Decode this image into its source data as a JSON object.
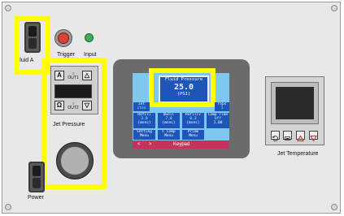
{
  "labels": {
    "fluid": "Fluid A",
    "trigger": "Trigger",
    "input": "Input",
    "jet_pressure": "Jet Pressure",
    "power": "Power",
    "jet_temperature": "Jet Temperature"
  },
  "pressure_controller": {
    "btn_a": "A",
    "btn_up": "△",
    "btn_omega": "Ω",
    "btn_down": "▽",
    "out1": "OUT1",
    "out2": "OUT2"
  },
  "touchscreen": {
    "popup": {
      "title": "Fluid Pressure",
      "value": "25.0",
      "unit": "(PSI)"
    },
    "row1": [
      {
        "label": "Jet",
        "value": "clos"
      },
      {
        "label": "rops",
        "value": "1"
      }
    ],
    "row2": [
      {
        "label": "Refill",
        "value": "3.0",
        "unit": "(msec)"
      },
      {
        "label": "Dwell",
        "value": "7.0",
        "unit": "(msec)"
      },
      {
        "label": "Refill+",
        "value": "0.3",
        "unit": "(msec)"
      },
      {
        "label": "Comp Time",
        "value": "Off",
        "unit": "1.00"
      }
    ],
    "row3": [
      {
        "label": "Setting",
        "value": "Menu"
      },
      {
        "label": "F Comp",
        "value": "Menu"
      },
      {
        "label": "Prime",
        "value": "Menu"
      }
    ],
    "keypad": {
      "lt": "<",
      "gt": ">",
      "label": "Keypad"
    }
  },
  "colors": {
    "highlight": "#ffff00",
    "screen": "#7ec8ef",
    "tile": "#1d56b8",
    "keybar": "#c8305e",
    "trigger": "#d9423a",
    "input_led": "#3fae5a"
  }
}
